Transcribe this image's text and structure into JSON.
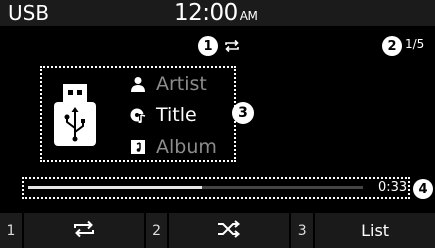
{
  "status_bar": {
    "source": "USB",
    "time": "12:00",
    "ampm": "AM"
  },
  "callouts": [
    "1",
    "2",
    "3",
    "4"
  ],
  "now_playing": {
    "repeat_icon": "repeat-icon",
    "track_counter": "1/5",
    "artist": "Artist",
    "title": "Title",
    "album": "Album",
    "album_art_icon": "usb-drive-icon",
    "elapsed": "0:33",
    "progress_fraction": 0.52
  },
  "softkeys": [
    {
      "number": "1",
      "icon": "repeat-icon",
      "label": ""
    },
    {
      "number": "2",
      "icon": "shuffle-icon",
      "label": ""
    },
    {
      "number": "3",
      "icon": "",
      "label": "List"
    }
  ],
  "colors": {
    "background": "#000000",
    "topbar": "#1b1b1b",
    "dim_text": "#8c8c8c",
    "progress_fill": "#e8e8e8"
  }
}
